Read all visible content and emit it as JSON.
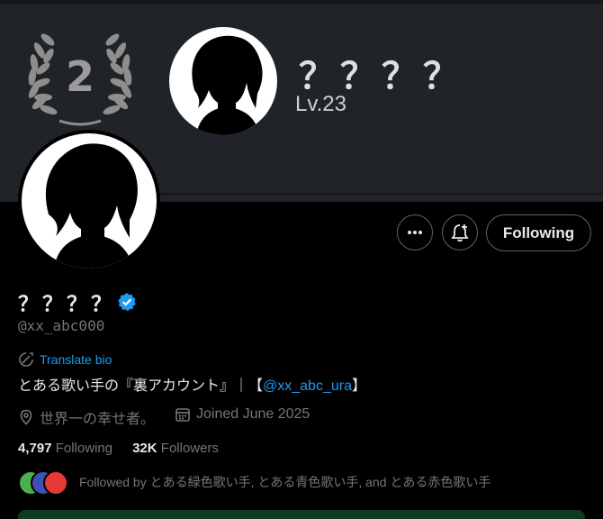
{
  "banner": {
    "rank": "2",
    "name": "？？？？",
    "level": "Lv.23"
  },
  "profile": {
    "display_name": "？？？？",
    "handle": "@xx_abc000",
    "translate_label": "Translate bio",
    "bio_text": "とある歌い手の『裏アカウント』｜【",
    "bio_link": "@xx_abc_ura",
    "bio_tail": "】",
    "location": "世界一の幸せ者。",
    "joined": "Joined June 2025",
    "following_count": "4,797",
    "following_label": "Following",
    "followers_count": "32K",
    "followers_label": "Followers",
    "followed_by": "Followed by とある緑色歌い手, とある青色歌い手, and とある赤色歌い手"
  },
  "actions": {
    "more_icon": "more-icon",
    "notify_icon": "bell-plus-icon",
    "follow_label": "Following"
  },
  "colors": {
    "accent": "#1d9bf0",
    "banner": "#202327",
    "mini_avatars": [
      "#4caf50",
      "#3f51b5",
      "#e53935"
    ]
  }
}
